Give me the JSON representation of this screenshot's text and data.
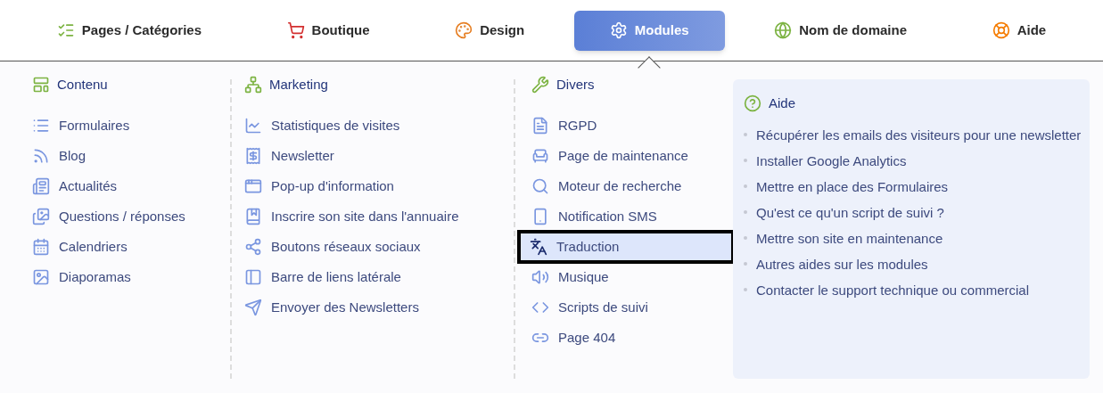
{
  "nav": [
    {
      "label": "Pages / Catégories",
      "selected": false
    },
    {
      "label": "Boutique",
      "selected": false
    },
    {
      "label": "Design",
      "selected": false
    },
    {
      "label": "Modules",
      "selected": true
    },
    {
      "label": "Nom de domaine",
      "selected": false
    },
    {
      "label": "Aide",
      "selected": false
    }
  ],
  "columns": [
    {
      "title": "Contenu",
      "items": [
        {
          "label": "Formulaires",
          "selected": false
        },
        {
          "label": "Blog",
          "selected": false
        },
        {
          "label": "Actualités",
          "selected": false
        },
        {
          "label": "Questions / réponses",
          "selected": false
        },
        {
          "label": "Calendriers",
          "selected": false
        },
        {
          "label": "Diaporamas",
          "selected": false
        }
      ]
    },
    {
      "title": "Marketing",
      "items": [
        {
          "label": "Statistiques de visites",
          "selected": false
        },
        {
          "label": "Newsletter",
          "selected": false
        },
        {
          "label": "Pop-up d'information",
          "selected": false
        },
        {
          "label": "Inscrire son site dans l'annuaire",
          "selected": false
        },
        {
          "label": "Boutons réseaux sociaux",
          "selected": false
        },
        {
          "label": "Barre de liens latérale",
          "selected": false
        },
        {
          "label": "Envoyer des Newsletters",
          "selected": false
        }
      ]
    },
    {
      "title": "Divers",
      "items": [
        {
          "label": "RGPD",
          "selected": false
        },
        {
          "label": "Page de maintenance",
          "selected": false
        },
        {
          "label": "Moteur de recherche",
          "selected": false
        },
        {
          "label": "Notification SMS",
          "selected": false
        },
        {
          "label": "Traduction",
          "selected": true
        },
        {
          "label": "Musique",
          "selected": false
        },
        {
          "label": "Scripts de suivi",
          "selected": false
        },
        {
          "label": "Page 404",
          "selected": false
        }
      ]
    }
  ],
  "help": {
    "title": "Aide",
    "links": [
      "Récupérer les emails des visiteurs pour une newsletter",
      "Installer Google Analytics",
      "Mettre en place des Formulaires",
      "Qu'est ce qu'un script de suivi ?",
      "Mettre son site en maintenance",
      "Autres aides sur les modules",
      "Contacter le support technique ou commercial"
    ]
  }
}
